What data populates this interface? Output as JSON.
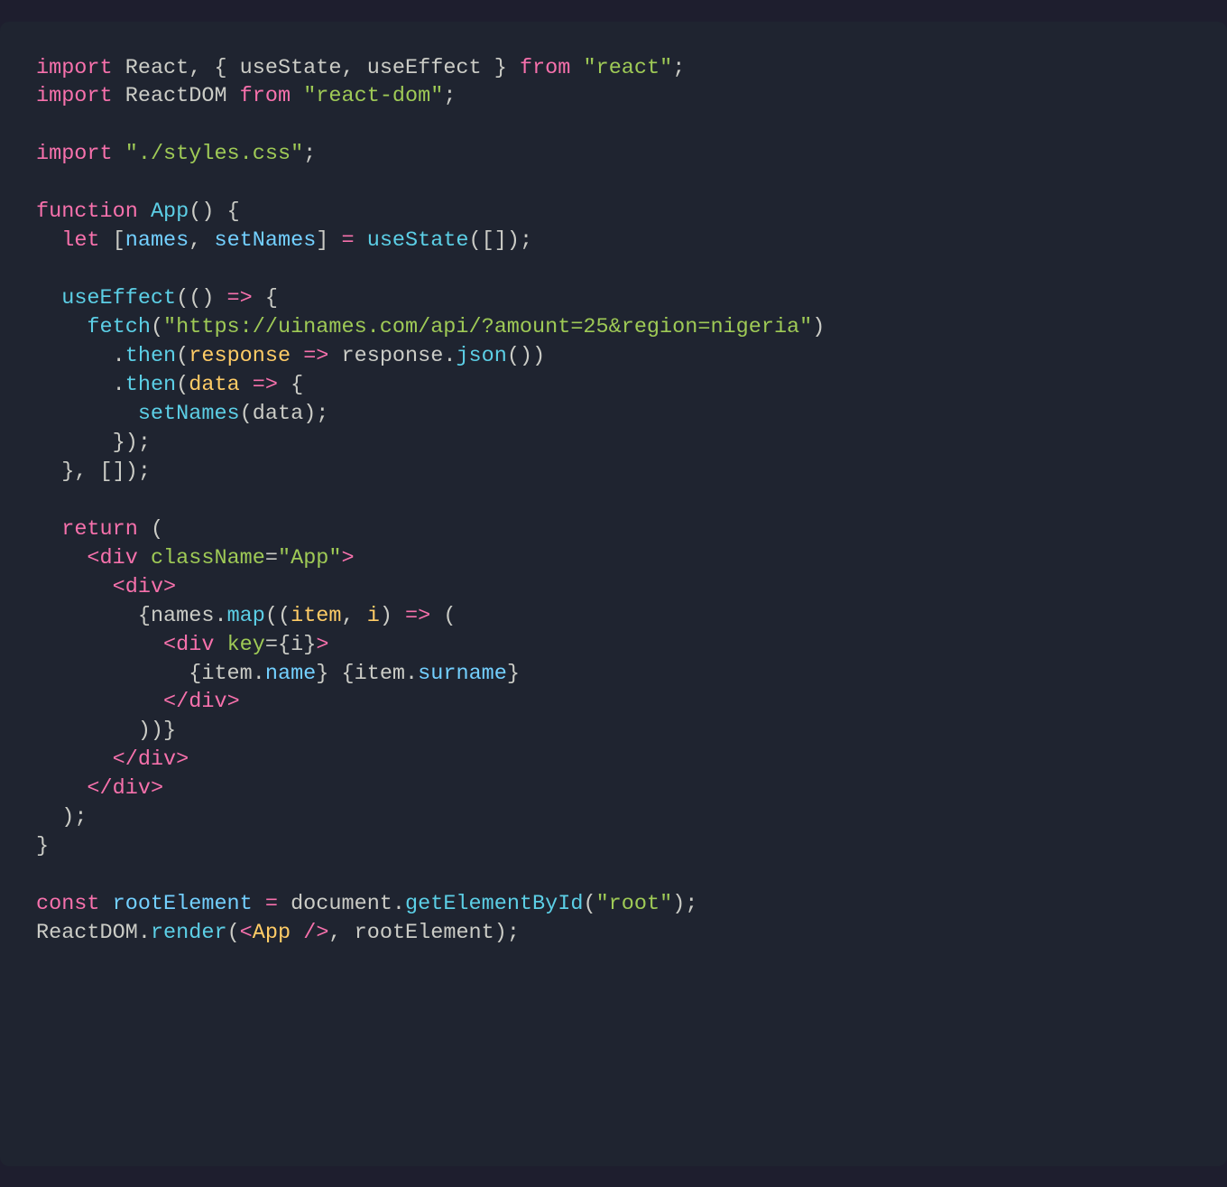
{
  "code": {
    "line1": {
      "import": "import",
      "React": "React",
      "comma1": ",",
      "lbrace": " { ",
      "useState": "useState",
      "comma2": ",",
      "useEffect": " useEffect",
      "rbrace": " } ",
      "from": "from",
      "module": "\"react\"",
      "semi": ";"
    },
    "line2": {
      "import": "import",
      "ReactDOM": "ReactDOM",
      "from": "from",
      "module": "\"react-dom\"",
      "semi": ";"
    },
    "line4": {
      "import": "import",
      "module": "\"./styles.css\"",
      "semi": ";"
    },
    "line6": {
      "function": "function",
      "App": "App",
      "parens": "()",
      "brace": " {"
    },
    "line7": {
      "let": "let",
      "lbracket": " [",
      "names": "names",
      "comma": ",",
      "setNames": " setNames",
      "rbracket": "]",
      "eq": " = ",
      "useState": "useState",
      "arg": "([]);"
    },
    "line9": {
      "useEffect": "useEffect",
      "open": "(()",
      "arrow": " => ",
      "brace": "{"
    },
    "line10": {
      "fetch": "fetch",
      "open": "(",
      "url": "\"https://uinames.com/api/?amount=25&region=nigeria\"",
      "close": ")"
    },
    "line11": {
      "dot": ".",
      "then": "then",
      "open": "(",
      "response": "response",
      "arrow": " => ",
      "response2": "response",
      "dot2": ".",
      "json": "json",
      "call": "())"
    },
    "line12": {
      "dot": ".",
      "then": "then",
      "open": "(",
      "data": "data",
      "arrow": " => ",
      "brace": "{"
    },
    "line13": {
      "setNames": "setNames",
      "open": "(",
      "data": "data",
      "close": ");"
    },
    "line14": {
      "close": "});"
    },
    "line15": {
      "close": "}, []);"
    },
    "line17": {
      "return": "return",
      "paren": " ("
    },
    "line18": {
      "open": "<",
      "tag": "div",
      "attr": "className",
      "eq": "=",
      "val": "\"App\"",
      "close": ">"
    },
    "line19": {
      "open": "<",
      "tag": "div",
      "close": ">"
    },
    "line20": {
      "lbrace": "{",
      "names": "names",
      "dot": ".",
      "map": "map",
      "open": "((",
      "item": "item",
      "comma": ",",
      "i": " i",
      "close": ")",
      "arrow": " => ",
      "paren": "("
    },
    "line21": {
      "open": "<",
      "tag": "div",
      "attr": "key",
      "eq": "=",
      "lbrace": "{",
      "i": "i",
      "rbrace": "}",
      "close": ">"
    },
    "line22": {
      "lbrace1": "{",
      "item1": "item",
      "dot1": ".",
      "name": "name",
      "rbrace1": "}",
      "space": " ",
      "lbrace2": "{",
      "item2": "item",
      "dot2": ".",
      "surname": "surname",
      "rbrace2": "}"
    },
    "line23": {
      "open": "</",
      "tag": "div",
      "close": ">"
    },
    "line24": {
      "close": "))}"
    },
    "line25": {
      "open": "</",
      "tag": "div",
      "close": ">"
    },
    "line26": {
      "open": "</",
      "tag": "div",
      "close": ">"
    },
    "line27": {
      "close": ");"
    },
    "line28": {
      "brace": "}"
    },
    "line30": {
      "const": "const",
      "rootElement": "rootElement",
      "eq": " = ",
      "document": "document",
      "dot": ".",
      "getElementById": "getElementById",
      "open": "(",
      "arg": "\"root\"",
      "close": ");"
    },
    "line31": {
      "ReactDOM": "ReactDOM",
      "dot": ".",
      "render": "render",
      "open": "(",
      "lt": "<",
      "App": "App",
      "slash": " /",
      "gt": ">",
      "comma": ",",
      "rootElement": " rootElement",
      "close": ");"
    }
  }
}
